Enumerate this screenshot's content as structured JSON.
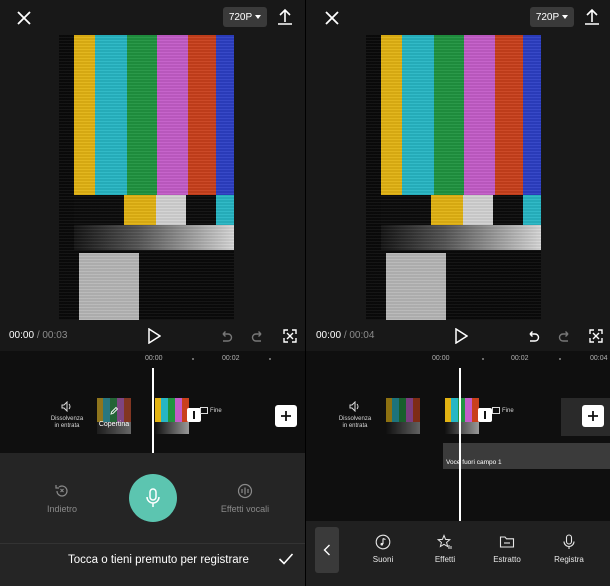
{
  "left_panel": {
    "resolution": "720P",
    "time_current": "00:00",
    "time_total": "00:03",
    "ruler": [
      "00:00",
      "00:02"
    ],
    "fade_label_line1": "Dissolvenza",
    "fade_label_line2": "in entrata",
    "cover_label": "Copertina",
    "end_label": "Fine",
    "recording": {
      "back_label": "Indietro",
      "effects_label": "Effetti vocali",
      "hint": "Tocca o tieni premuto per registrare"
    }
  },
  "right_panel": {
    "resolution": "720P",
    "time_current": "00:00",
    "time_total": "00:04",
    "ruler": [
      "00:00",
      "00:02",
      "00:04"
    ],
    "fade_label_line1": "Dissolvenza",
    "fade_label_line2": "in entrata",
    "end_label": "Fine",
    "voice_track_label": "Voce fuori campo 1",
    "toolbar": [
      "Suoni",
      "Effetti",
      "Estratto",
      "Registra"
    ]
  },
  "icons": [
    "close-icon",
    "export-icon",
    "play-icon",
    "undo-icon",
    "redo-icon",
    "fullscreen-icon",
    "speaker-icon",
    "pencil-icon",
    "split-icon",
    "plus-icon",
    "rewind-icon",
    "voice-effects-icon",
    "microphone-icon",
    "check-icon",
    "chevron-left-icon",
    "music-note-icon",
    "star-effects-icon",
    "folder-icon"
  ],
  "colors": {
    "accent": "#5cc5b0",
    "background": "#181818",
    "timeline": "#0f0f0f",
    "panel": "#252525"
  }
}
